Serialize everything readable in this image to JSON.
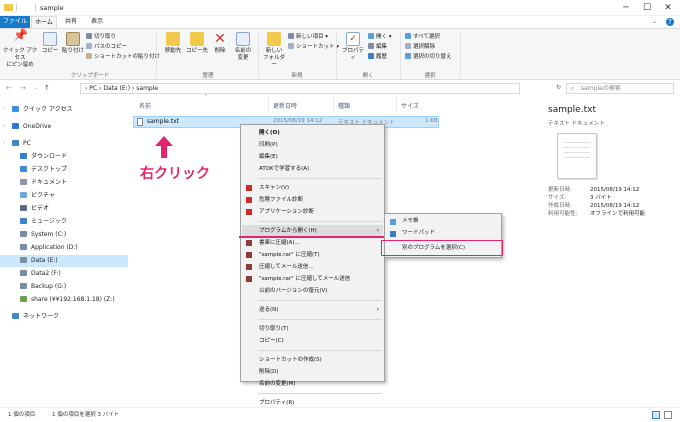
{
  "window": {
    "title": "sample",
    "controls": {
      "minimize": "─",
      "maximize": "☐",
      "close": "✕"
    },
    "help": "?"
  },
  "tabs": [
    "ファイル",
    "ホーム",
    "共有",
    "表示"
  ],
  "ribbon": {
    "pin_label": "クイック アクセス\nにピン留め",
    "copy_label": "コピー",
    "paste_label": "貼り付け",
    "cut_label": "切り取り",
    "copy_path_label": "パスのコピー",
    "paste_shortcut_label": "ショートカットの貼り付け",
    "clipboard_group": "クリップボード",
    "move_to_label": "移動先",
    "copy_to_label": "コピー先",
    "delete_label": "削除",
    "rename_label": "名前の\n変更",
    "organize_group": "整理",
    "new_folder_label": "新しい\nフォルダー",
    "new_item_label": "新しい項目 ▾",
    "shortcut_label": "ショートカット ▾",
    "new_group": "新規",
    "properties_label": "プロパティ",
    "open_label": "開く ▾",
    "edit_label": "編集",
    "history_label": "履歴",
    "open_group": "開く",
    "select_all_label": "すべて選択",
    "select_none_label": "選択解除",
    "invert_select_label": "選択の切り替え",
    "select_group": "選択"
  },
  "address": {
    "path": "›  PC  ›  Data (E:)  ›  sample",
    "search_placeholder": "sampleの検索"
  },
  "nav": [
    {
      "label": "クイック アクセス",
      "color": "#3a8ee6"
    },
    {
      "label": "OneDrive",
      "color": "#2b78d4"
    },
    {
      "label": "PC",
      "color": "#3d88c8"
    },
    {
      "label": "ダウンロード",
      "color": "#2f7fd1"
    },
    {
      "label": "デスクトップ",
      "color": "#3c8dd8"
    },
    {
      "label": "ドキュメント",
      "color": "#8a95a6"
    },
    {
      "label": "ピクチャ",
      "color": "#6aa9e0"
    },
    {
      "label": "ビデオ",
      "color": "#5c6c82"
    },
    {
      "label": "ミュージック",
      "color": "#3f7fcf"
    },
    {
      "label": "System (C:)",
      "color": "#7a8da3"
    },
    {
      "label": "Application (D:)",
      "color": "#7a8da3"
    },
    {
      "label": "Data (E:)",
      "color": "#7a8da3"
    },
    {
      "label": "Data2 (F:)",
      "color": "#7a8da3"
    },
    {
      "label": "Backup (G:)",
      "color": "#7a8da3"
    },
    {
      "label": "share (¥¥192.168.1.18) (Z:)",
      "color": "#6fa04a"
    },
    {
      "label": "ネットワーク",
      "color": "#3d88c8"
    }
  ],
  "columns": {
    "name": "名前",
    "date": "更新日時",
    "type": "種類",
    "size": "サイズ"
  },
  "file": {
    "name": "sample.txt",
    "date": "2015/08/19 14:12",
    "type": "テキスト ドキュメント",
    "size": "1 KB"
  },
  "annotation": {
    "label": "右クリック",
    "color": "#e4246d"
  },
  "context_menu": [
    {
      "label": "開く(O)",
      "bold": true
    },
    {
      "label": "印刷(P)"
    },
    {
      "label": "編集(E)"
    },
    {
      "label": "ATOKで学習する(A)"
    },
    {
      "sep": true
    },
    {
      "label": "スキャン(V)",
      "icon": "#c9302c"
    },
    {
      "label": "危険ファイル診断",
      "icon": "#c9302c"
    },
    {
      "label": "アプリケーション診断",
      "icon": "#c9302c"
    },
    {
      "sep": true
    },
    {
      "label": "プログラムから開く(H)",
      "submenu": true,
      "highlight": true
    },
    {
      "label": "書庫に圧縮(A)...",
      "icon": "#8c3a3a"
    },
    {
      "label": "\"sample.rar\" に圧縮(T)",
      "icon": "#8c3a3a"
    },
    {
      "label": "圧縮してメール送信...",
      "icon": "#8c3a3a"
    },
    {
      "label": "\"sample.rar\" に圧縮してメール送信",
      "icon": "#8c3a3a"
    },
    {
      "label": "以前のバージョンの復元(V)"
    },
    {
      "sep": true
    },
    {
      "label": "送る(N)",
      "submenu": true
    },
    {
      "sep": true
    },
    {
      "label": "切り取り(T)"
    },
    {
      "label": "コピー(C)"
    },
    {
      "sep": true
    },
    {
      "label": "ショートカットの作成(S)"
    },
    {
      "label": "削除(D)"
    },
    {
      "label": "名前の変更(M)"
    },
    {
      "sep": true
    },
    {
      "label": "プロパティ(R)"
    }
  ],
  "submenu": [
    {
      "label": "メモ帳",
      "icon": "#5aa0d8"
    },
    {
      "label": "ワードパッド",
      "icon": "#3b7fc4"
    },
    {
      "label": "別のプログラムを選択(C)"
    }
  ],
  "details": {
    "filename": "sample.txt",
    "filetype": "テキスト ドキュメント",
    "rows": [
      {
        "k": "更新日時:",
        "v": "2015/08/19 14:12"
      },
      {
        "k": "サイズ:",
        "v": "3 バイト"
      },
      {
        "k": "作成日時:",
        "v": "2015/08/19 14:12"
      },
      {
        "k": "利用可能性:",
        "v": "オフラインで利用可能"
      }
    ]
  },
  "status": {
    "count": "1 個の項目",
    "selected": "1 個の項目を選択  3 バイト"
  }
}
